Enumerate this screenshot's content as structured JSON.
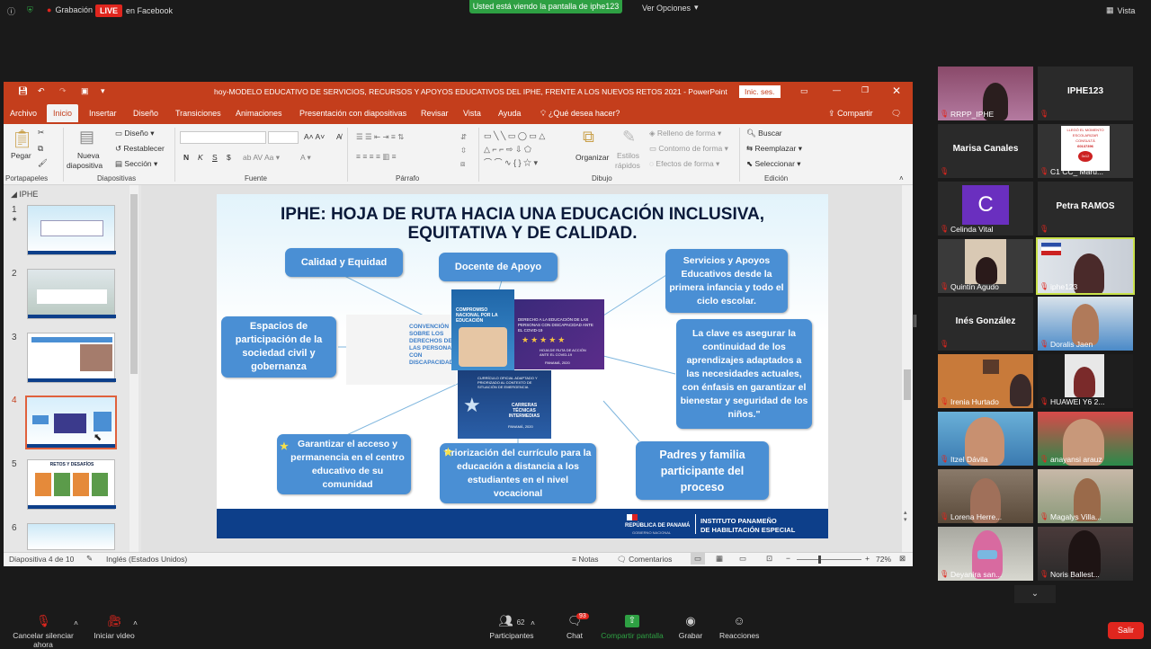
{
  "topbar": {
    "recording": "Grabación",
    "live": "LIVE",
    "on_facebook": "en Facebook",
    "banner": "Usted está viendo la pantalla de iphe123",
    "view_options": "Ver Opciones",
    "view": "Vista"
  },
  "ppt": {
    "doc_title": "hoy-MODELO EDUCATIVO DE SERVICIOS, RECURSOS Y APOYOS EDUCATIVOS DEL IPHE, FRENTE  A LOS NUEVOS RETOS 2021  -  PowerPoint",
    "signin": "Inic. ses.",
    "tabs": [
      "Archivo",
      "Inicio",
      "Insertar",
      "Diseño",
      "Transiciones",
      "Animaciones",
      "Presentación con diapositivas",
      "Revisar",
      "Vista",
      "Ayuda",
      "¿Qué desea hacer?"
    ],
    "share": "Compartir",
    "ribbon": {
      "pegar": "Pegar",
      "nueva": "Nueva",
      "diapositiva": "diapositiva",
      "diseno": "Diseño",
      "restablecer": "Restablecer",
      "seccion": "Sección",
      "organizar": "Organizar",
      "estilos": "Estilos",
      "rapidos": "rápidos",
      "relleno": "Relleno de forma",
      "contorno": "Contorno de forma",
      "efectos": "Efectos de forma",
      "buscar": "Buscar",
      "reemplazar": "Reemplazar",
      "seleccionar": "Seleccionar",
      "groups": [
        "Portapapeles",
        "Diapositivas",
        "Fuente",
        "Párrafo",
        "Dibujo",
        "Edición"
      ],
      "font_buttons": [
        "N",
        "K",
        "S",
        "$"
      ]
    },
    "section": "IPHE",
    "slide_numbers": [
      "1",
      "2",
      "3",
      "4",
      "5",
      "6"
    ],
    "thumb5_title": "RETOS Y DESAFÍOS",
    "status": {
      "slide": "Diapositiva 4 de 10",
      "lang": "Inglés (Estados Unidos)",
      "notes": "Notas",
      "comments": "Comentarios",
      "zoom": "72%"
    }
  },
  "slide": {
    "title_line1": "IPHE: HOJA DE RUTA HACIA UNA EDUCACIÓN INCLUSIVA,",
    "title_line2": "EQUITATIVA Y DE CALIDAD.",
    "box_calidad": "Calidad y Equidad",
    "box_docente": "Docente de Apoyo",
    "box_servicios": "Servicios y Apoyos Educativos desde la primera infancia y todo el ciclo escolar.",
    "box_espacios": "Espacios de participación de la sociedad civil y gobernanza",
    "box_clave": "La clave es asegurar la continuidad de los aprendizajes adaptados a las necesidades actuales, con énfasis en garantizar el bienestar y seguridad de los niños.\"",
    "box_garantizar": "Garantizar el acceso y permanencia en el centro educativo  de su comunidad",
    "box_priorizacion": "Priorización  del currículo para la educación a distancia a los estudiantes en el nivel vocacional",
    "box_padres": "Padres y  familia participante del proceso",
    "convention": "CONVENCIÓN SOBRE LOS DERECHOS DE LAS PERSONAS CON DISCAPACIDAD",
    "book1": "COMPROMISO NACIONAL POR LA EDUCACIÓN",
    "book2_a": "DERECHO A LA EDUCACIÓN DE LAS PERSONAS CON DISCAPACIDAD ANTE EL COVID-19",
    "book2_b": "HOJA DE RUTA DE ACCIÓN ANTE EL COVID-19",
    "book2_c": "PANAMÁ, 2020",
    "book3_a": "CURRÍCULO OFICIAL ADAPTADO Y PRIORIZADO AL CONTEXTO DE SITUACIÓN DE EMERGENCIA",
    "book3_b": "CARRERAS TÉCNICAS INTERMEDIAS",
    "book3_c": "PANAMÁ, 2020",
    "footer_gov": "REPÚBLICA DE PANAMÁ",
    "footer_gov2": "GOBIERNO NACIONAL",
    "footer_inst1": "INSTITUTO PANAMEÑO",
    "footer_inst2": "DE HABILITACIÓN ESPECIAL"
  },
  "participants": [
    {
      "name": "RRPP_IPHE",
      "type": "video"
    },
    {
      "name": "IPHE123",
      "type": "name"
    },
    {
      "name": "Marisa Canales",
      "type": "name"
    },
    {
      "name": "C1 CC_ Maru...",
      "type": "video"
    },
    {
      "name": "Celinda Vital",
      "type": "avatar",
      "initial": "C"
    },
    {
      "name": "Petra RAMOS",
      "type": "name"
    },
    {
      "name": "Quintín Agudo",
      "type": "video"
    },
    {
      "name": "iphe123",
      "type": "video"
    },
    {
      "name": "Inés González",
      "type": "name"
    },
    {
      "name": "Doralis Jaen",
      "type": "video"
    },
    {
      "name": "Irenia Hurtado",
      "type": "video"
    },
    {
      "name": "HUAWEI Y6 2...",
      "type": "video"
    },
    {
      "name": "Itzel Dávila",
      "type": "video"
    },
    {
      "name": "anayansi arauz",
      "type": "video"
    },
    {
      "name": "Lorena Herre...",
      "type": "video"
    },
    {
      "name": "Magalys Villa...",
      "type": "video"
    },
    {
      "name": "Deyanira san...",
      "type": "video"
    },
    {
      "name": "Noris Ballest...",
      "type": "video"
    }
  ],
  "poster": {
    "line1": "LLEGÓ EL MOMENTO",
    "line2": "ESCOLARIZAR",
    "line3": "CONSULTÁ",
    "num": "60137396",
    "date": "3x12"
  },
  "bottom": {
    "mute": "Cancelar silenciar ahora",
    "video": "Iniciar video",
    "participants": "Participantes",
    "participants_count": "62",
    "chat": "Chat",
    "chat_count": "93",
    "share": "Compartir pantalla",
    "record": "Grabar",
    "reactions": "Reacciones",
    "leave": "Salir"
  },
  "colors": {
    "ppt_red": "#c43e1c",
    "box_blue": "#4a8fd4",
    "zoom_green": "#2ea043",
    "live_red": "#e0261e"
  }
}
